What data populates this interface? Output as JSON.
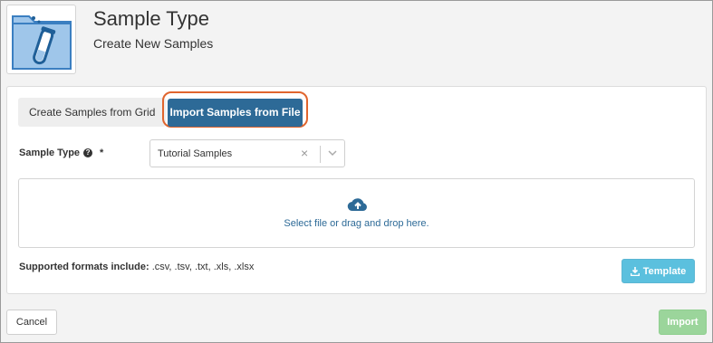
{
  "header": {
    "title": "Sample Type",
    "subtitle": "Create New Samples",
    "icon": "folder-test-tube-icon"
  },
  "tabs": [
    {
      "label": "Create Samples from Grid",
      "active": false
    },
    {
      "label": "Import Samples from File",
      "active": true
    }
  ],
  "form": {
    "sample_type_label": "Sample Type",
    "required_marker": "*",
    "help_icon": "question-circle-icon",
    "sample_type_value": "Tutorial Samples",
    "clear_icon": "×"
  },
  "dropzone": {
    "icon": "cloud-upload-icon",
    "text": "Select file or drag and drop here."
  },
  "formats": {
    "label": "Supported formats include:",
    "list": ".csv, .tsv, .txt, .xls, .xlsx"
  },
  "buttons": {
    "template": "Template",
    "cancel": "Cancel",
    "import": "Import"
  },
  "colors": {
    "primary": "#2d6a97",
    "highlight_ring": "#e0652e",
    "info": "#5bc0de",
    "success_disabled": "#9bd59b",
    "folder": "#9fc6ea"
  }
}
